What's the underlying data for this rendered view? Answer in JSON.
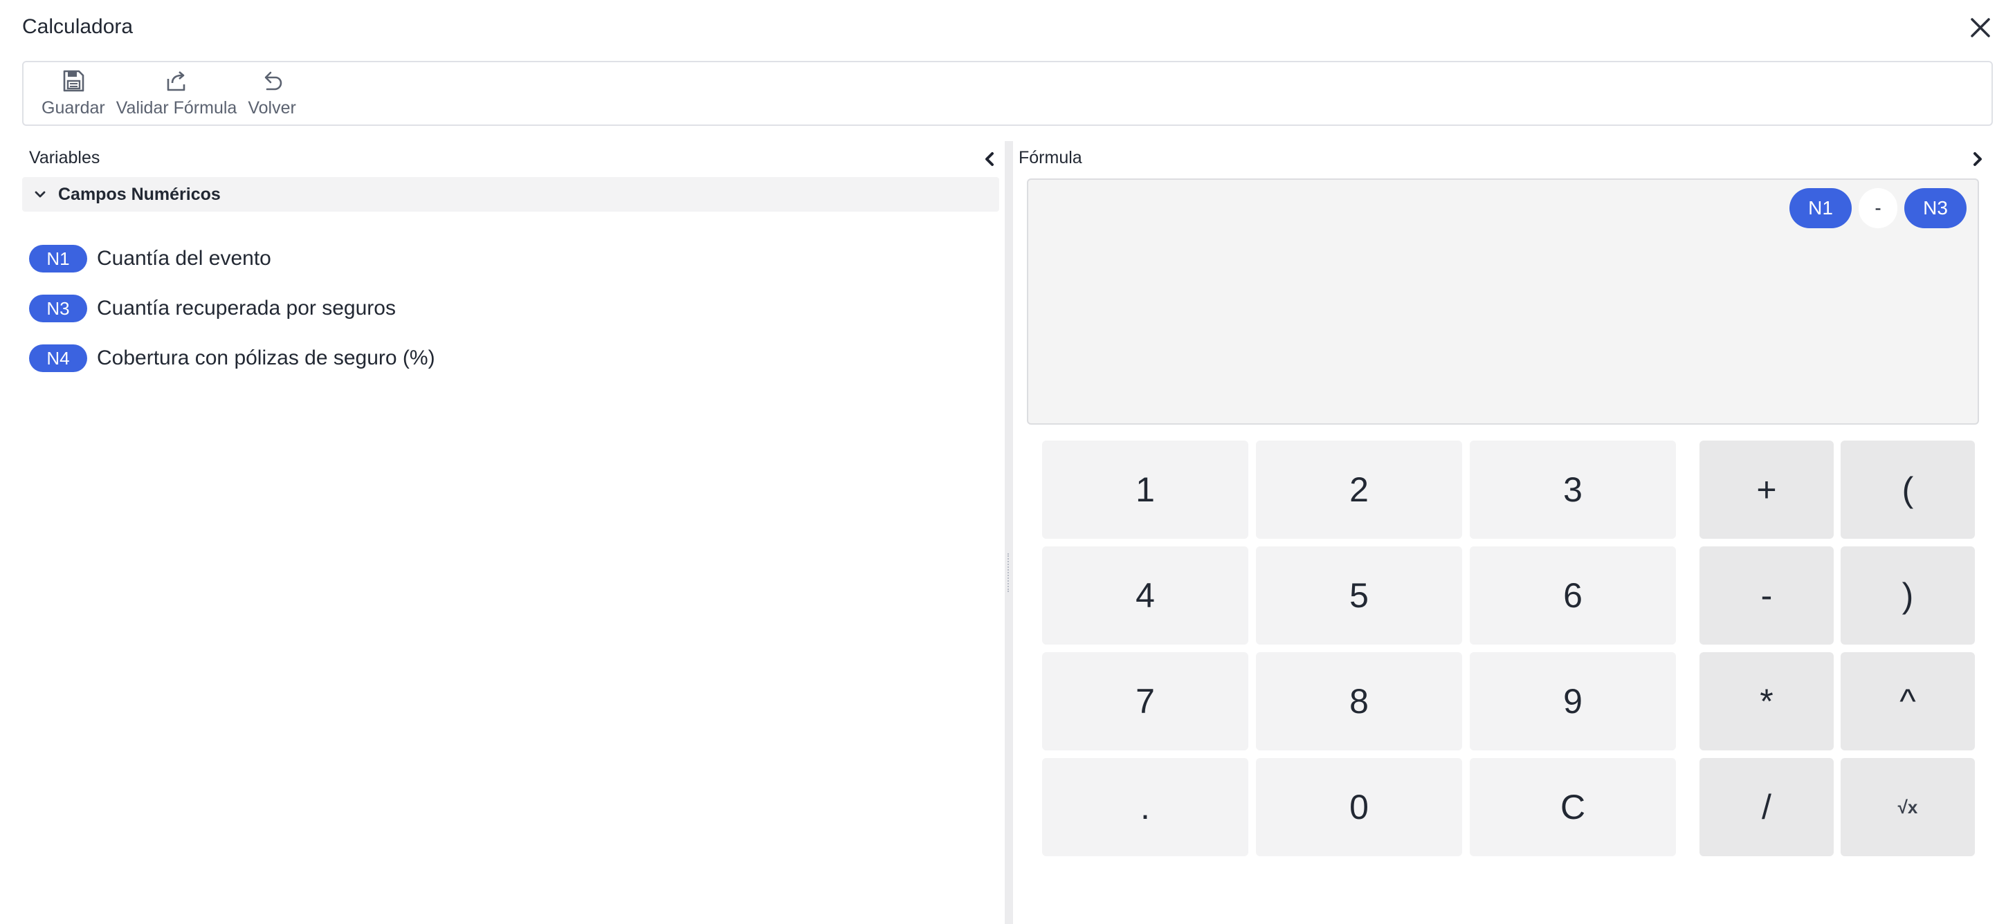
{
  "window": {
    "title": "Calculadora"
  },
  "toolbar": {
    "save_label": "Guardar",
    "validate_label": "Validar Fórmula",
    "back_label": "Volver"
  },
  "variables_panel": {
    "heading": "Variables",
    "group_title": "Campos Numéricos",
    "items": [
      {
        "code": "N1",
        "label": "Cuantía del evento"
      },
      {
        "code": "N3",
        "label": "Cuantía recuperada por seguros"
      },
      {
        "code": "N4",
        "label": "Cobertura con pólizas de seguro (%)"
      }
    ]
  },
  "formula_panel": {
    "heading": "Fórmula",
    "tokens": [
      "N1",
      "-",
      "N3"
    ]
  },
  "keypad": {
    "numbers": [
      "1",
      "2",
      "3",
      "4",
      "5",
      "6",
      "7",
      "8",
      "9",
      ".",
      "0",
      "C"
    ],
    "operators": [
      "+",
      "(",
      "-",
      ")",
      "*",
      "^",
      "/",
      "√x"
    ]
  },
  "colors": {
    "accent": "#3b63e0",
    "key_bg": "#f3f3f4",
    "operator_key_bg": "#e8e8e9"
  },
  "icons": {
    "save": "floppy-disk-icon",
    "validate": "share-arrow-icon",
    "back": "undo-icon",
    "close": "close-icon"
  }
}
